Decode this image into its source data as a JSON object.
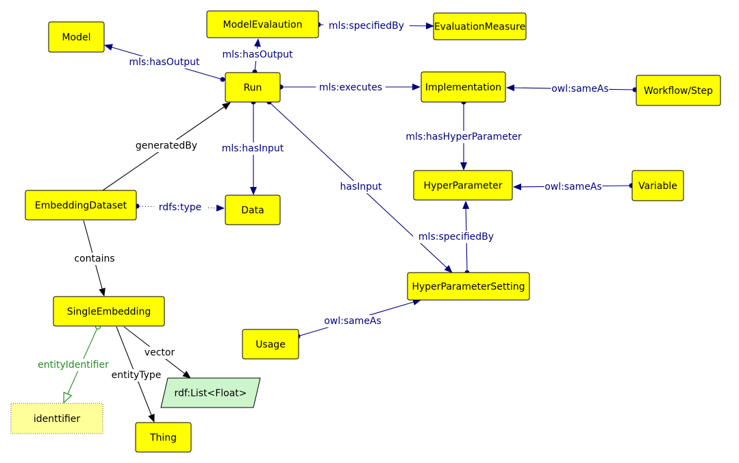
{
  "colors": {
    "class_fill": "#ffff00",
    "class_stroke": "#000000",
    "datatype_fill": "#ccf5cc",
    "individual_fill": "#ffff99",
    "navy_edge": "#000080",
    "black_edge": "#000000",
    "green_edge": "#228b22"
  },
  "nodes": {
    "model": {
      "label": "Model",
      "kind": "class"
    },
    "modelEval": {
      "label": "ModelEvalaution",
      "kind": "class"
    },
    "evalMeasure": {
      "label": "EvaluationMeasure",
      "kind": "class"
    },
    "run": {
      "label": "Run",
      "kind": "class"
    },
    "implementation": {
      "label": "Implementation",
      "kind": "class"
    },
    "workflow": {
      "label": "Workflow/Step",
      "kind": "class"
    },
    "embeddingDataset": {
      "label": "EmbeddingDataset",
      "kind": "class"
    },
    "data": {
      "label": "Data",
      "kind": "class"
    },
    "hyperParameter": {
      "label": "HyperParameter",
      "kind": "class"
    },
    "variable": {
      "label": "Variable",
      "kind": "class"
    },
    "hpSetting": {
      "label": "HyperParameterSetting",
      "kind": "class"
    },
    "singleEmbedding": {
      "label": "SingleEmbedding",
      "kind": "class"
    },
    "usage": {
      "label": "Usage",
      "kind": "class"
    },
    "floatList": {
      "label": "rdf:List<Float>",
      "kind": "datatype"
    },
    "identifier": {
      "label": "identtifier",
      "kind": "individual"
    },
    "thing": {
      "label": "Thing",
      "kind": "class"
    }
  },
  "edges": [
    {
      "id": "e1",
      "from": "run",
      "to": "model",
      "label": "mls:hasOutput",
      "style": "navy"
    },
    {
      "id": "e2",
      "from": "run",
      "to": "modelEval",
      "label": "mls:hasOutput",
      "style": "navy"
    },
    {
      "id": "e3",
      "from": "modelEval",
      "to": "evalMeasure",
      "label": "mls:specifiedBy",
      "style": "navy"
    },
    {
      "id": "e4",
      "from": "run",
      "to": "implementation",
      "label": "mls:executes",
      "style": "navy"
    },
    {
      "id": "e5",
      "from": "workflow",
      "to": "implementation",
      "label": "owl:sameAs",
      "style": "navy"
    },
    {
      "id": "e6",
      "from": "implementation",
      "to": "hyperParameter",
      "label": "mls:hasHyperParameter",
      "style": "navy"
    },
    {
      "id": "e7",
      "from": "variable",
      "to": "hyperParameter",
      "label": "owl:sameAs",
      "style": "navy"
    },
    {
      "id": "e8",
      "from": "hpSetting",
      "to": "hyperParameter",
      "label": "mls:specifiedBy",
      "style": "navy"
    },
    {
      "id": "e9",
      "from": "run",
      "to": "hpSetting",
      "label": "hasInput",
      "style": "navy"
    },
    {
      "id": "e10",
      "from": "run",
      "to": "data",
      "label": "mls:hasInput",
      "style": "navy"
    },
    {
      "id": "e11",
      "from": "embeddingDataset",
      "to": "run",
      "label": "generatedBy",
      "style": "black"
    },
    {
      "id": "e12",
      "from": "embeddingDataset",
      "to": "data",
      "label": "rdfs:type",
      "style": "dotted"
    },
    {
      "id": "e13",
      "from": "embeddingDataset",
      "to": "singleEmbedding",
      "label": "contains",
      "style": "black"
    },
    {
      "id": "e14",
      "from": "usage",
      "to": "hpSetting",
      "label": "owl:sameAs",
      "style": "navy"
    },
    {
      "id": "e15",
      "from": "singleEmbedding",
      "to": "identifier",
      "label": "entityIdentifier",
      "style": "green"
    },
    {
      "id": "e16",
      "from": "singleEmbedding",
      "to": "thing",
      "label": "entityType",
      "style": "black"
    },
    {
      "id": "e17",
      "from": "singleEmbedding",
      "to": "floatList",
      "label": "vector",
      "style": "black"
    }
  ]
}
